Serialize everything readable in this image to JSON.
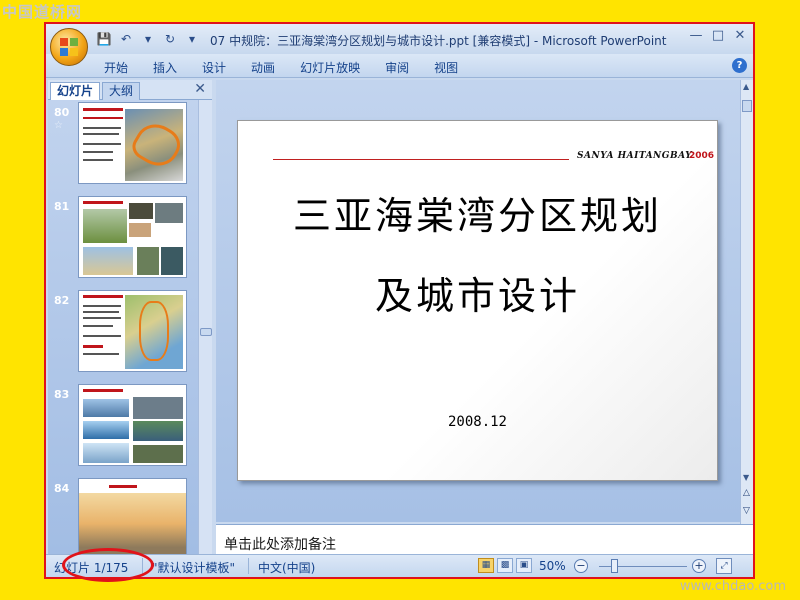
{
  "watermark": {
    "top": "中国道桥网",
    "bottom": "www.chdao.com"
  },
  "window": {
    "title": "07 中规院：三亚海棠湾分区规划与城市设计.ppt [兼容模式] - Microsoft PowerPoint"
  },
  "ribbon": {
    "tabs": [
      "开始",
      "插入",
      "设计",
      "动画",
      "幻灯片放映",
      "审阅",
      "视图"
    ]
  },
  "left_pane": {
    "tab_slides": "幻灯片",
    "tab_outline": "大纲",
    "thumbnails": [
      {
        "number": "80",
        "star": "☆"
      },
      {
        "number": "81"
      },
      {
        "number": "82"
      },
      {
        "number": "83"
      },
      {
        "number": "84"
      }
    ]
  },
  "slide": {
    "brand": "SANYA HAITANGBAY",
    "year": "2006",
    "title_line1": "三亚海棠湾分区规划",
    "title_line2": "及城市设计",
    "date": "2008.12"
  },
  "notes": {
    "placeholder": "单击此处添加备注"
  },
  "status_bar": {
    "slide_counter": "幻灯片 1/175",
    "theme": "\"默认设计模板\"",
    "language": "中文(中国)",
    "zoom": "50%",
    "zoom_fraction": 0.5
  }
}
